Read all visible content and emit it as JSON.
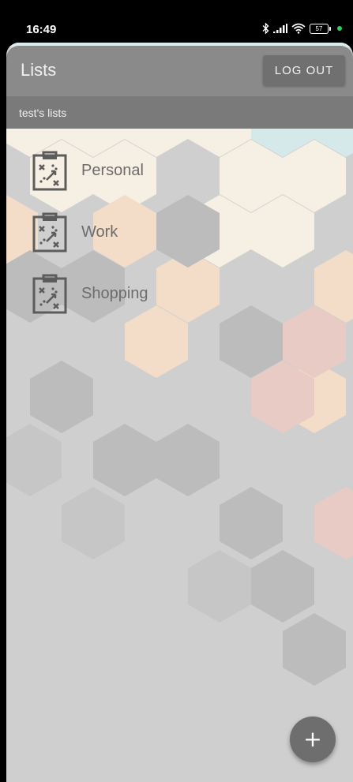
{
  "status_bar": {
    "time": "16:49",
    "battery_level": "57",
    "icons": [
      "bluetooth-icon",
      "signal-icon",
      "wifi-icon",
      "battery-icon",
      "notification-dot"
    ]
  },
  "app_bar": {
    "title": "Lists",
    "logout_label": "LOG OUT"
  },
  "subheader": {
    "text": "test's lists"
  },
  "lists": [
    {
      "label": "Personal",
      "icon": "clipboard-strategy-icon"
    },
    {
      "label": "Work",
      "icon": "clipboard-strategy-icon"
    },
    {
      "label": "Shopping",
      "icon": "clipboard-strategy-icon"
    }
  ],
  "fab": {
    "label": "+",
    "icon": "add-icon"
  },
  "colors": {
    "app_bar": "#8a8a8a",
    "subheader": "#7a7a7a",
    "background": "#cfcfcf",
    "logout_button": "#707070",
    "fab": "#6e6e6e"
  }
}
